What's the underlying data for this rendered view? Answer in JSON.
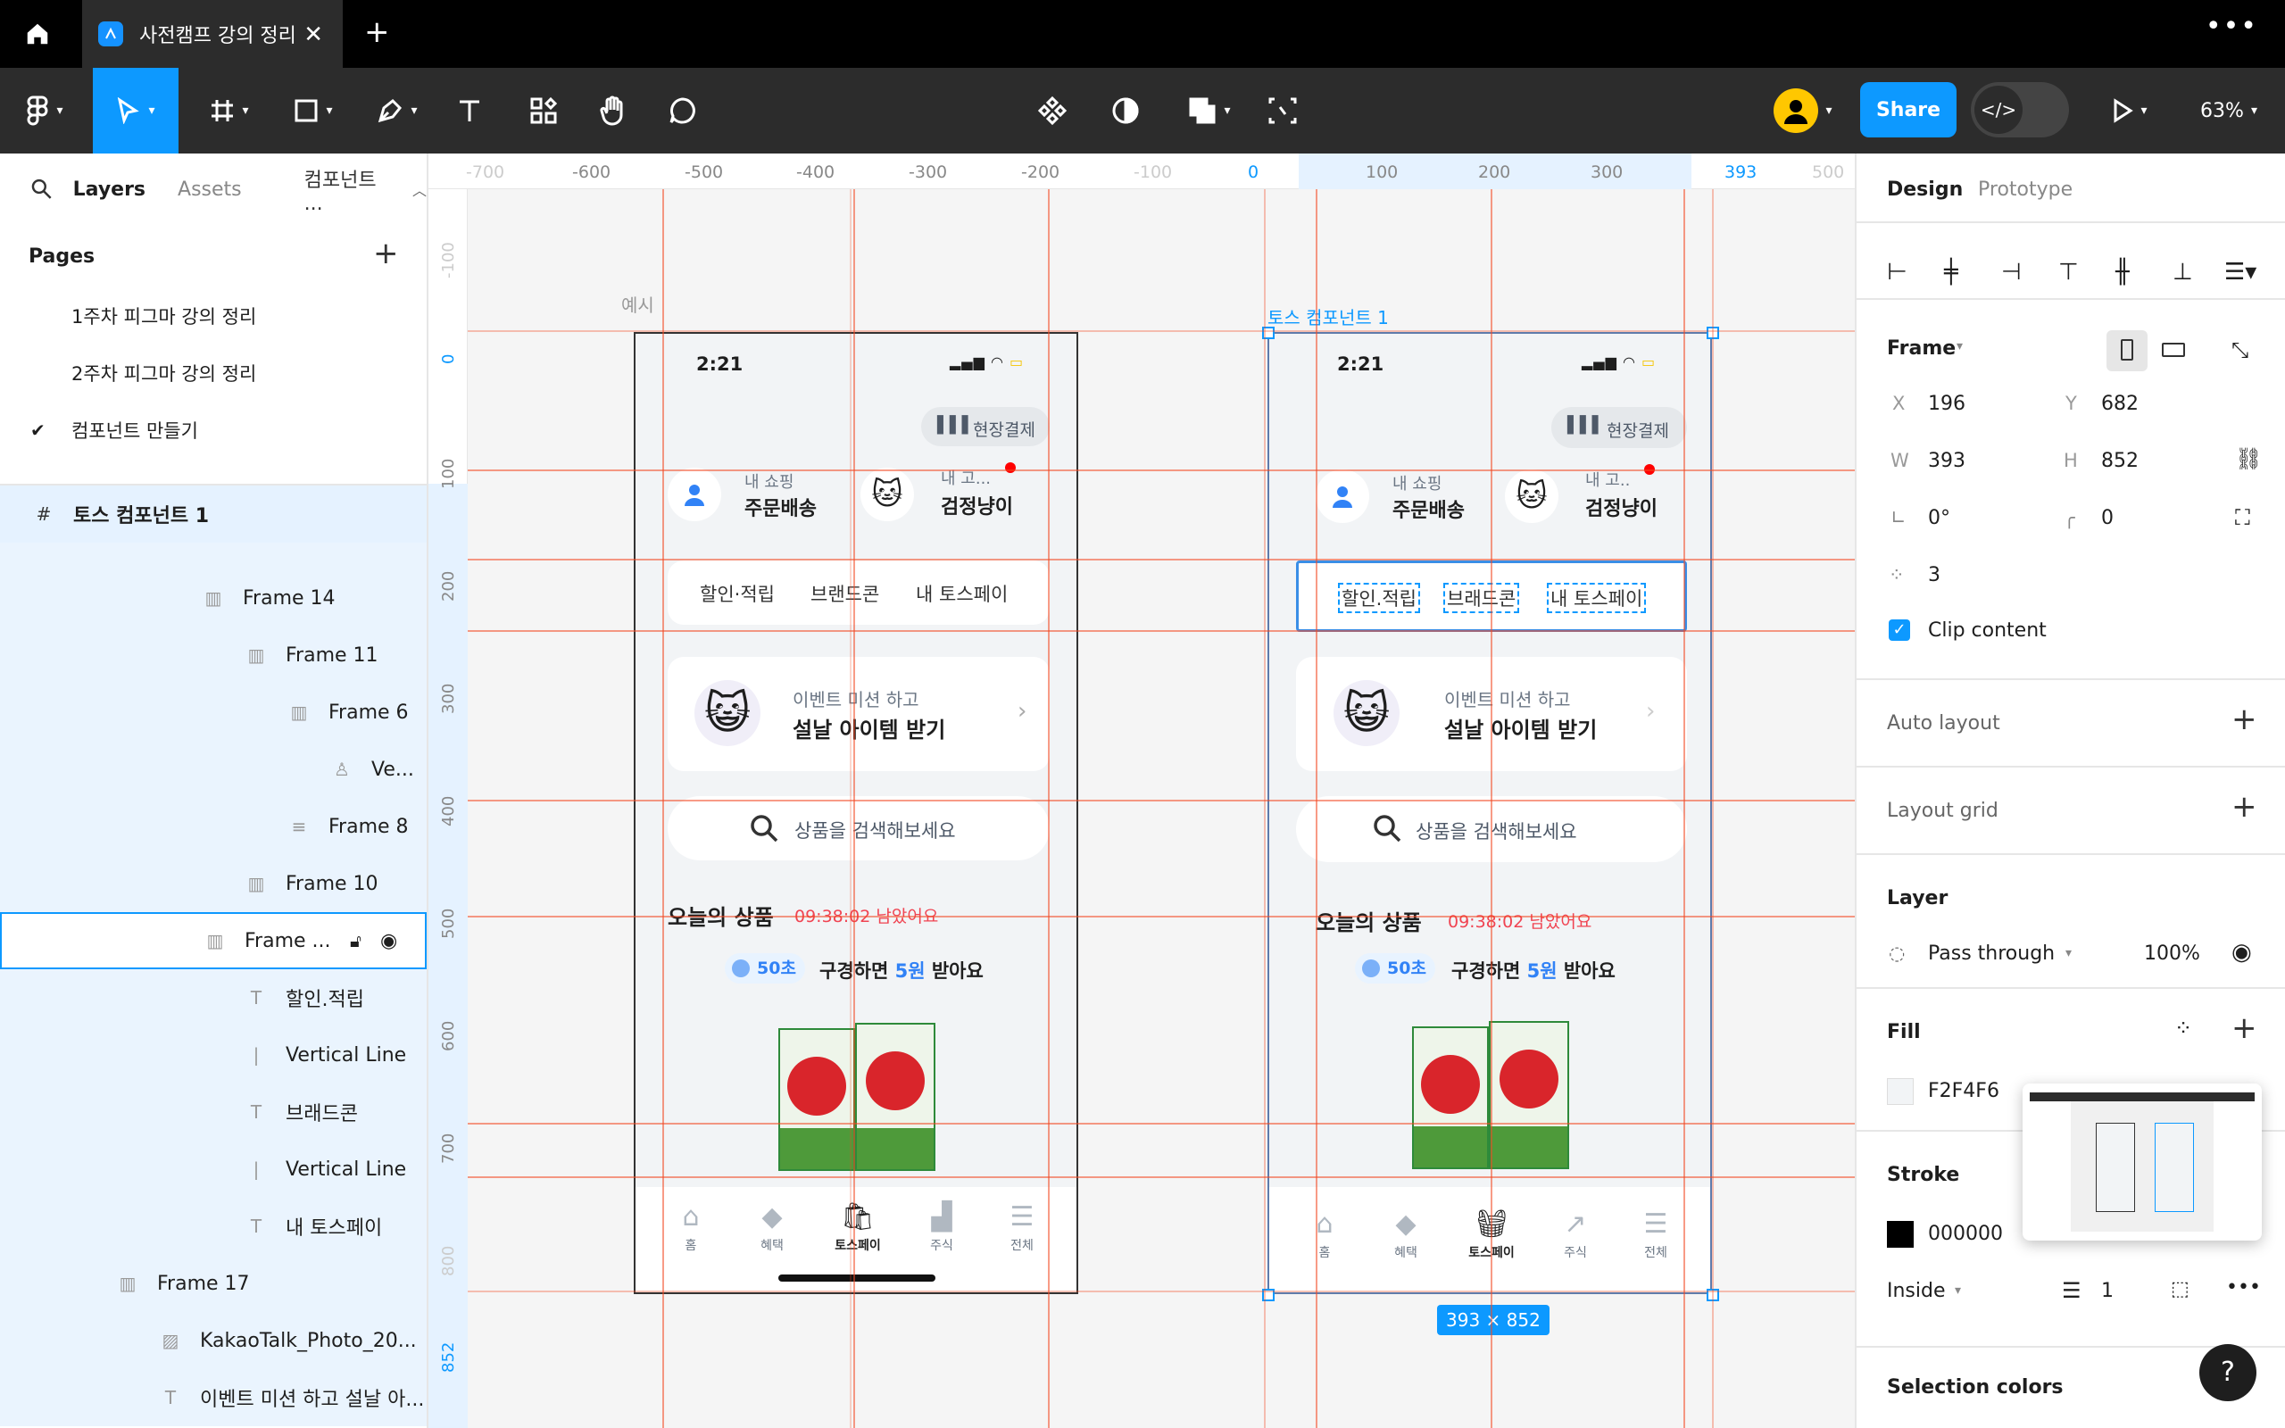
{
  "tab": {
    "title": "사전캠프 강의 정리"
  },
  "toolbar": {
    "share": "Share",
    "zoom": "63%"
  },
  "left": {
    "tabs": {
      "layers": "Layers",
      "assets": "Assets",
      "page": "컴포넌트 ..."
    },
    "pages_header": "Pages",
    "pages": [
      "1주차 피그마 강의 정리",
      "2주차 피그마 강의 정리",
      "컴포넌트 만들기"
    ],
    "layers": [
      {
        "label": "토스 컴포넌트 1"
      },
      {
        "label": "Frame 14"
      },
      {
        "label": "Frame 11"
      },
      {
        "label": "Frame 6"
      },
      {
        "label": "Ve..."
      },
      {
        "label": "Frame 8"
      },
      {
        "label": "Frame 10"
      },
      {
        "label": "Frame ..."
      },
      {
        "label": "할인.적립"
      },
      {
        "label": "Vertical Line"
      },
      {
        "label": "브래드콘"
      },
      {
        "label": "Vertical Line"
      },
      {
        "label": "내 토스페이"
      },
      {
        "label": "Frame 17"
      },
      {
        "label": "KakaoTalk_Photo_20..."
      },
      {
        "label": "이벤트 미션 하고 설날 아..."
      }
    ]
  },
  "canvas": {
    "ruler_h": [
      "-700",
      "-600",
      "-500",
      "-400",
      "-300",
      "-200",
      "-100",
      "0",
      "100",
      "200",
      "300",
      "393",
      "500"
    ],
    "ruler_v": [
      "-100",
      "0",
      "100",
      "200",
      "300",
      "400",
      "500",
      "600",
      "700",
      "800",
      "852"
    ],
    "label_example": "예시",
    "label_frame": "토스 컴포넌트 1",
    "size_badge": "393 × 852",
    "phone": {
      "time": "2:21",
      "pay_btn": "현장결제",
      "shop_small": "내 쇼핑",
      "shop_big": "주문배송",
      "cat_small": "내 고...",
      "cat_small2": "내 고..",
      "cat_big": "검정냥이",
      "tab1": "할인·적립",
      "tab1b": "할인.적립",
      "tab2": "브랜드콘",
      "tab2b": "브래드콘",
      "tab3": "내 토스페이",
      "event_small": "이벤트 미션 하고",
      "event_big": "설날 아이템 받기",
      "search": "상품을 검색해보세요",
      "today": "오늘의 상품",
      "timer": "09:38:02 남았어요",
      "sec": "50초",
      "reward_a": "구경하면",
      "reward_b": "5원",
      "reward_c": "받아요",
      "nav": [
        "홈",
        "혜택",
        "토스페이",
        "주식",
        "전체"
      ]
    }
  },
  "right": {
    "tabs": {
      "design": "Design",
      "prototype": "Prototype"
    },
    "frame": "Frame",
    "x_label": "X",
    "x": "196",
    "y_label": "Y",
    "y": "682",
    "w_label": "W",
    "w": "393",
    "h_label": "H",
    "h": "852",
    "rotation": "0°",
    "radius": "0",
    "spacing": "3",
    "clip": "Clip content",
    "auto_layout": "Auto layout",
    "layout_grid": "Layout grid",
    "layer": "Layer",
    "blend": "Pass through",
    "opacity": "100%",
    "fill": "Fill",
    "fill_hex": "F2F4F6",
    "stroke": "Stroke",
    "stroke_hex": "000000",
    "stroke_pos": "Inside",
    "stroke_w": "1",
    "selection_colors": "Selection colors",
    "help": "?"
  },
  "colors": {
    "accent": "#0d99ff",
    "guide": "#f24822",
    "toss_blue": "#3182f6",
    "timer_red": "#f04452"
  }
}
